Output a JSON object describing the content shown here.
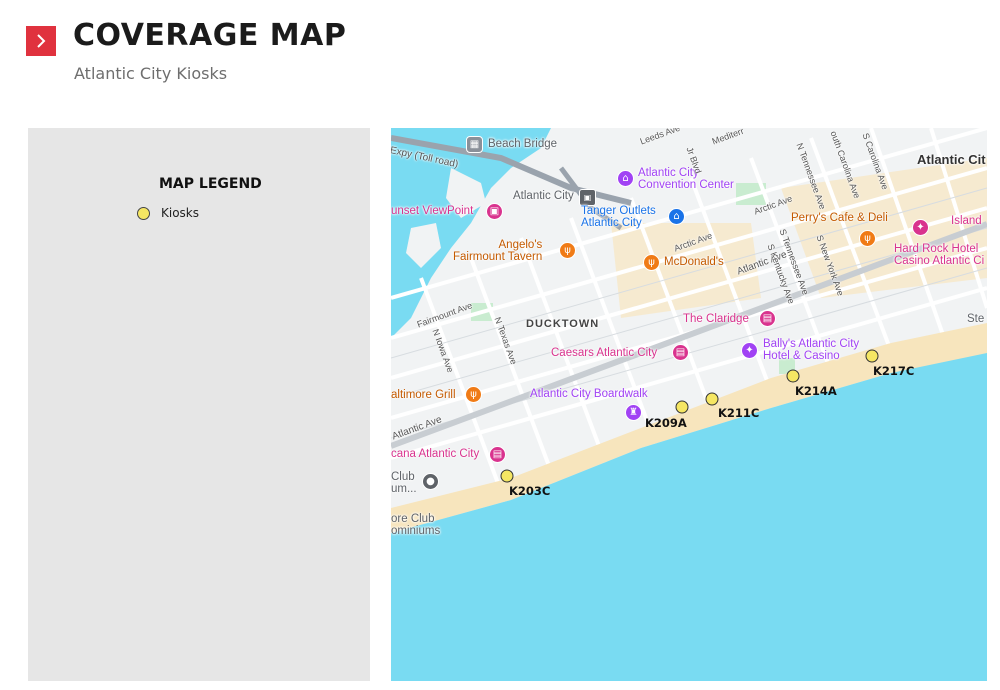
{
  "header": {
    "title": "COVERAGE MAP",
    "subtitle": "Atlantic City Kiosks",
    "accent_color": "#e0323e",
    "icon": "chevron-right-icon"
  },
  "legend": {
    "title": "MAP LEGEND",
    "items": [
      {
        "label": "Kiosks",
        "color": "#f5e663"
      }
    ]
  },
  "map": {
    "water_color": "#79dbf2",
    "beach_color": "#f7e5bd",
    "pois": {
      "beach_bridge": "Beach Bridge",
      "atlantic_city_station": "Atlantic City",
      "convention_center": "Atlantic City\nConvention Center",
      "tanger_outlets": "Tanger Outlets\nAtlantic City",
      "sunset_viewpoint": "unset ViewPoint",
      "angelos": "Angelo's\nFairmount Tavern",
      "mcdonalds": "McDonald's",
      "perrys": "Perry's Cafe & Deli",
      "hard_rock": "Hard Rock Hotel\nCasino Atlantic Ci",
      "island": "Island",
      "claridge": "The Claridge",
      "caesars": "Caesars Atlantic City",
      "ballys": "Bally's Atlantic City\nHotel & Casino",
      "baltimore_grill": "altimore Grill",
      "boardwalk": "Atlantic City Boardwalk",
      "tropicana": "cana Atlantic City",
      "club_um": "Club\num...",
      "shore_club": "ore Club\nominiums",
      "ste": "Ste"
    },
    "areas": {
      "ducktown": "DUCKTOWN",
      "city": "Atlantic Cit"
    },
    "streets": {
      "expy": "Expy (Toll road)",
      "leeds": "Leeds Ave",
      "jr_blvd": "Jr Blvd",
      "mediterr": "Mediterr",
      "arctic1": "Arctic Ave",
      "arctic2": "Arctic Ave",
      "atlantic1": "Atlantic Ave",
      "atlantic2": "Atlantic Ave",
      "n_tennessee": "N Tennessee Ave",
      "s_carolina": "outh Carolina Ave",
      "n_carolina": "S Carolina Ave",
      "s_tennessee": "S Tennessee Ave",
      "s_kentucky": "S Kentucky Ave",
      "s_new_york": "S New York Ave",
      "fairmount": "Fairmount Ave",
      "n_iowa": "N Iowa Ave",
      "n_texas": "N Texas Ave"
    },
    "kiosks": [
      {
        "id": "K203C"
      },
      {
        "id": "K209A"
      },
      {
        "id": "K211C"
      },
      {
        "id": "K214A"
      },
      {
        "id": "K217C"
      }
    ]
  }
}
